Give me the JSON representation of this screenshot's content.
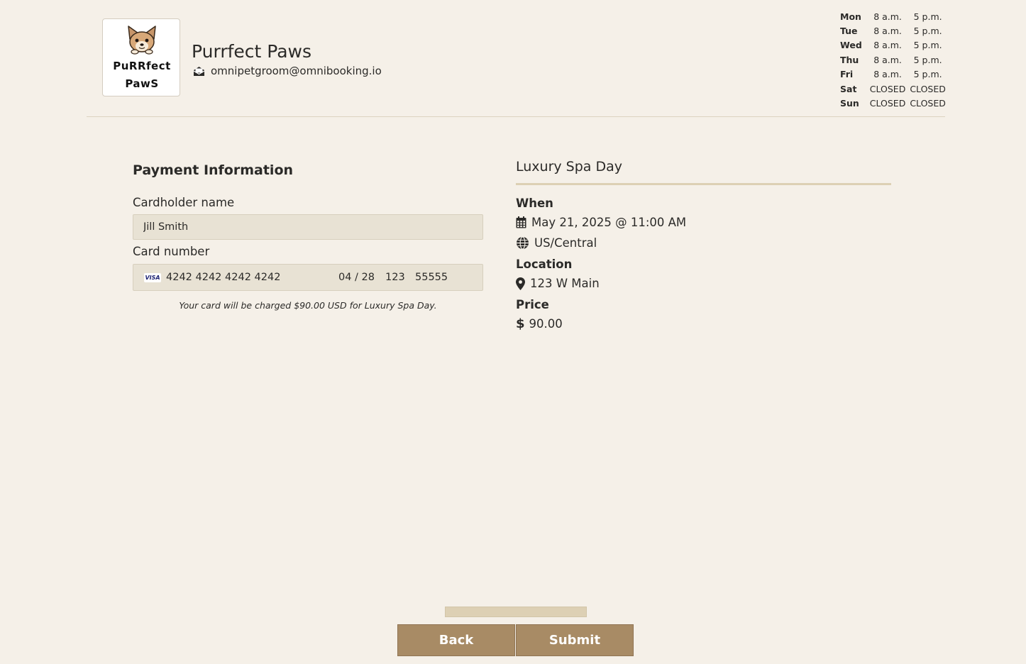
{
  "business": {
    "name": "Purrfect Paws",
    "email": "omnipetgroom@omnibooking.io",
    "logo_line1": "PuRRfect",
    "logo_line2": "PawS"
  },
  "hours": [
    {
      "day": "Mon",
      "open": "8 a.m.",
      "close": "5 p.m."
    },
    {
      "day": "Tue",
      "open": "8 a.m.",
      "close": "5 p.m."
    },
    {
      "day": "Wed",
      "open": "8 a.m.",
      "close": "5 p.m."
    },
    {
      "day": "Thu",
      "open": "8 a.m.",
      "close": "5 p.m."
    },
    {
      "day": "Fri",
      "open": "8 a.m.",
      "close": "5 p.m."
    },
    {
      "day": "Sat",
      "open": "CLOSED",
      "close": "CLOSED"
    },
    {
      "day": "Sun",
      "open": "CLOSED",
      "close": "CLOSED"
    }
  ],
  "payment": {
    "title": "Payment Information",
    "cardholder_label": "Cardholder name",
    "cardholder_value": "Jill Smith",
    "card_label": "Card number",
    "card_brand": "VISA",
    "card_number": "4242 4242 4242 4242",
    "expiry": "04 / 28",
    "cvc": "123",
    "zip": "55555",
    "charge_note": "Your card will be charged $90.00 USD for Luxury Spa Day."
  },
  "summary": {
    "service": "Luxury Spa Day",
    "when_label": "When",
    "datetime": "May 21, 2025 @ 11:00 AM",
    "timezone": "US/Central",
    "location_label": "Location",
    "location": "123 W Main",
    "price_label": "Price",
    "price": "90.00"
  },
  "actions": {
    "back_label": "Back",
    "submit_label": "Submit"
  },
  "colors": {
    "background": "#f5f0e8",
    "button": "#a88b65",
    "input": "#e8e2d4",
    "accent": "#ddd0b4"
  }
}
